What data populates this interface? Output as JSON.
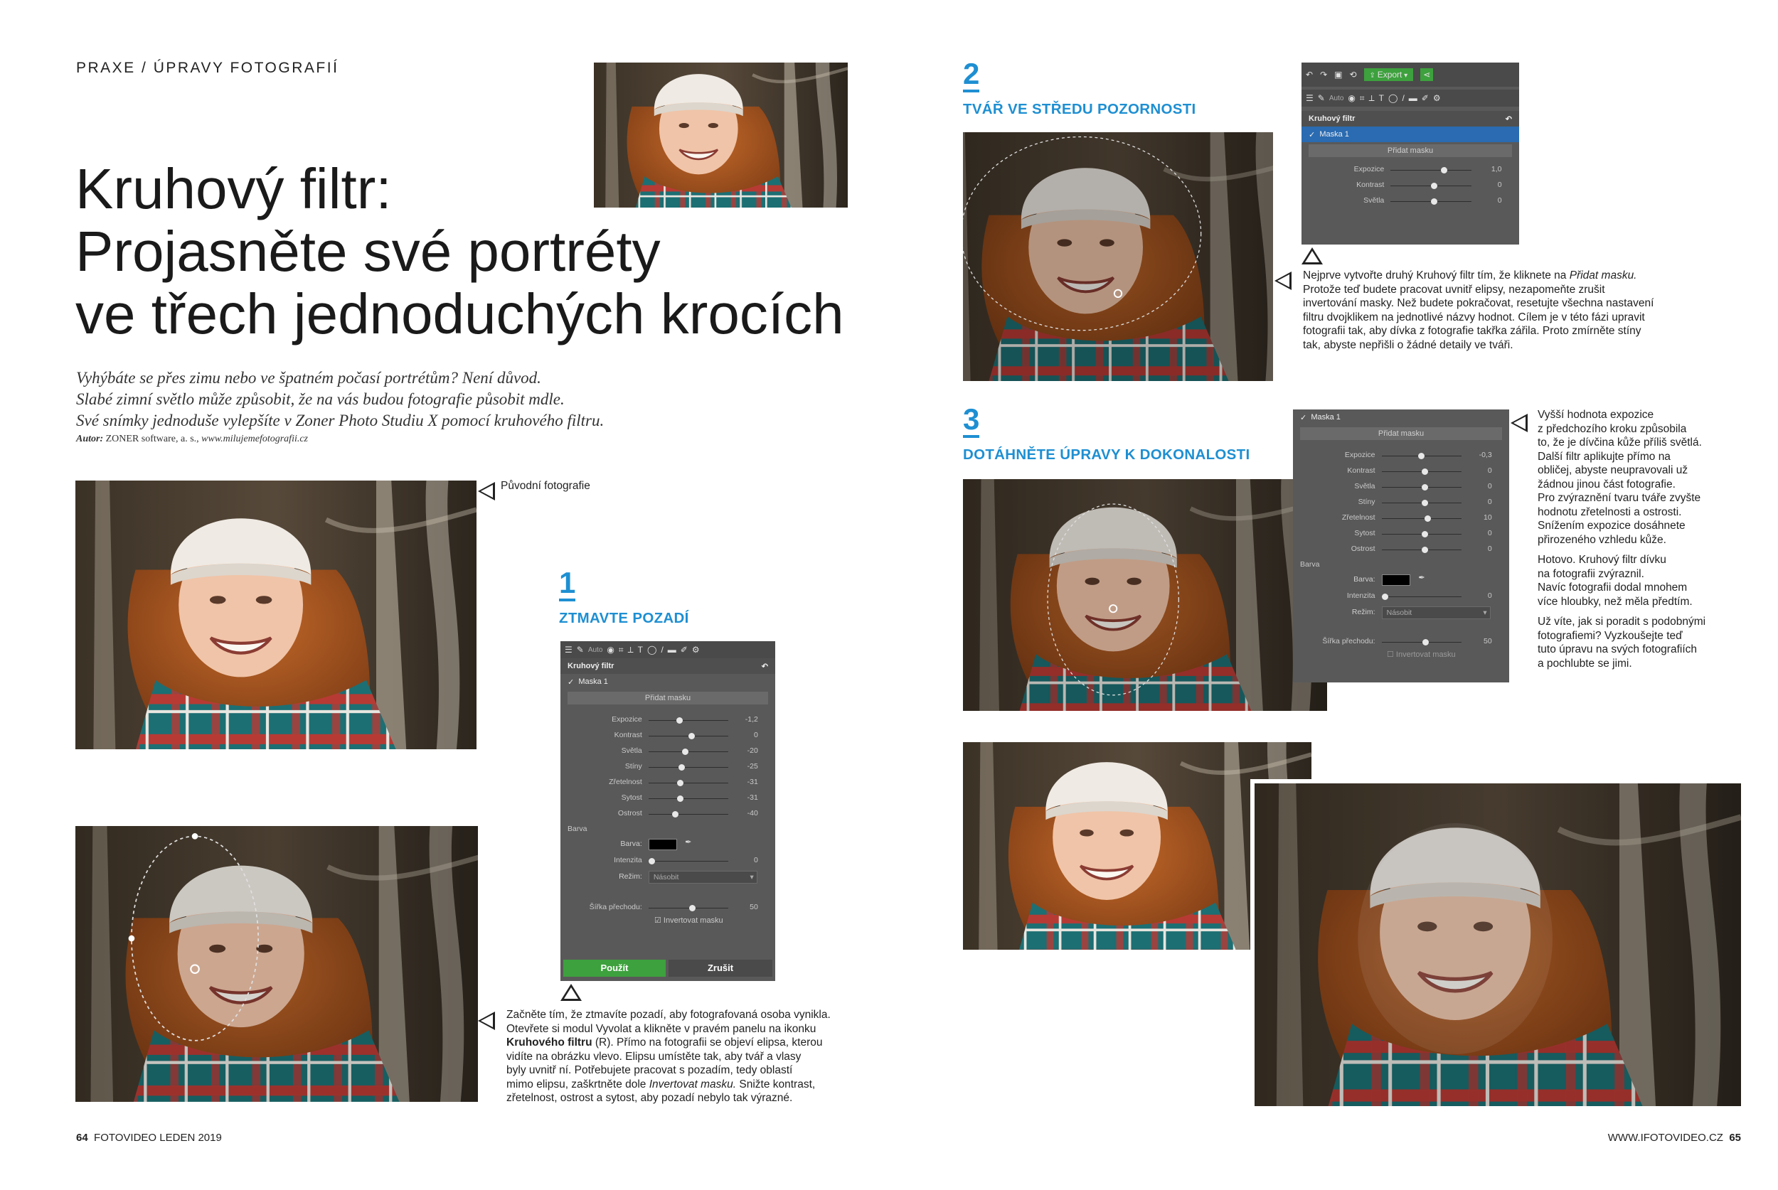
{
  "header": {
    "section": "PRAXE / ÚPRAVY FOTOGRAFIÍ"
  },
  "title": {
    "line1": "Kruhový filtr:",
    "line2": "Projasněte své portréty",
    "line3": "ve třech jednoduchých krocích"
  },
  "intro": {
    "line1": "Vyhýbáte se přes zimu nebo ve špatném počasí portrétům? Není důvod.",
    "line2": "Slabé zimní světlo může způsobit, že na vás budou fotografie působit mdle.",
    "line3": "Své snímky jednoduše vylepšíte v Zoner Photo Studiu X pomocí kruhového filtru.",
    "author_label": "Autor:",
    "author_name": "ZONER software, a. s.,",
    "author_url": "www.milujemefotografii.cz"
  },
  "captions": {
    "original": "Původní fotografie",
    "step1": {
      "l1": "Začněte tím, že ztmavíte pozadí, aby fotografovaná osoba vynikla.",
      "l2": "Otevřete si modul Vyvolat a klikněte v pravém panelu na ikonku",
      "l3b": "Kruhového filtru",
      "l3": " (R). Přímo na fotografii se objeví elipsa, kterou",
      "l4": "vidíte na obrázku vlevo. Elipsu umístěte tak, aby tvář a vlasy",
      "l5": "byly uvnitř ní. Potřebujete pracovat s pozadím, tedy oblastí",
      "l6a": "mimo elipsu, zaškrtněte dole ",
      "l6i": "Invertovat masku.",
      "l6b": " Snižte kontrast,",
      "l7": "zřetelnost, ostrost a sytost, aby pozadí nebylo tak výrazné."
    },
    "step2": {
      "l1a": "Nejprve vytvořte druhý Kruhový filtr tím, že kliknete na ",
      "l1i": "Přidat masku.",
      "l2": "Protože teď budete pracovat uvnitř elipsy, nezapomeňte zrušit",
      "l3": "invertování masky. Než budete pokračovat, resetujte všechna nastavení",
      "l4": "filtru dvojklikem na jednotlivé názvy hodnot. Cílem je v této fázi upravit",
      "l5": "fotografii tak, aby dívka z fotografie takřka zářila. Proto zmírněte stíny",
      "l6": "tak, abyste nepřišli o žádné detaily ve tváři."
    },
    "step3": {
      "p1": [
        "Vyšší hodnota expozice",
        "z předchozího kroku způsobila",
        "to, že je dívčina kůže příliš světlá.",
        "Další filtr aplikujte přímo na",
        "obličej, abyste neupravovali už",
        "žádnou jinou část fotografie.",
        "Pro zvýraznění tvaru tváře zvyšte",
        "hodnotu zřetelnosti a ostrosti.",
        "Snížením expozice dosáhnete",
        "přirozeného vzhledu kůže."
      ],
      "p2": [
        "Hotovo. Kruhový filtr dívku",
        "na fotografii zvýraznil.",
        "Navíc fotografii dodal mnohem",
        "více hloubky, než měla předtím."
      ],
      "p3": [
        "Už víte, jak si poradit s podobnými",
        "fotografiemi? Vyzkoušejte teď",
        "tuto úpravu na svých fotografiích",
        "a pochlubte se jimi."
      ]
    }
  },
  "steps": {
    "s1": {
      "num": "1",
      "title": "ZTMAVTE POZADÍ"
    },
    "s2": {
      "num": "2",
      "title": "TVÁŘ VE STŘEDU POZORNOSTI"
    },
    "s3": {
      "num": "3",
      "title": "DOTÁHNĚTE ÚPRAVY K DOKONALOSTI"
    }
  },
  "panel1": {
    "auto": "Auto",
    "filter_title": "Kruhový filtr",
    "mask": "Maska 1",
    "add_mask": "Přidat masku",
    "sliders": [
      {
        "label": "Expozice",
        "value": "-1,2",
        "pos": 0.35
      },
      {
        "label": "Kontrast",
        "value": "0",
        "pos": 0.5
      },
      {
        "label": "Světla",
        "value": "-20",
        "pos": 0.42
      },
      {
        "label": "Stíny",
        "value": "-25",
        "pos": 0.38
      },
      {
        "label": "Zřetelnost",
        "value": "-31",
        "pos": 0.36
      },
      {
        "label": "Sytost",
        "value": "-31",
        "pos": 0.36
      },
      {
        "label": "Ostrost",
        "value": "-40",
        "pos": 0.3
      }
    ],
    "color_section": "Barva",
    "color_label": "Barva:",
    "intensity_label": "Intenzita",
    "intensity_value": "0",
    "mode_label": "Režim:",
    "mode_value": "Násobit",
    "feather_label": "Šířka přechodu:",
    "feather_value": "50",
    "invert_label": "Invertovat masku",
    "apply": "Použít",
    "cancel": "Zrušit"
  },
  "panel2": {
    "auto": "Auto",
    "export": "Export",
    "filter_title": "Kruhový filtr",
    "mask": "Maska 1",
    "add_mask": "Přidat masku",
    "sliders": [
      {
        "label": "Expozice",
        "value": "1,0",
        "pos": 0.62
      },
      {
        "label": "Kontrast",
        "value": "0",
        "pos": 0.5
      },
      {
        "label": "Světla",
        "value": "0",
        "pos": 0.5
      }
    ]
  },
  "panel3": {
    "mask": "Maska 1",
    "add_mask": "Přidat masku",
    "sliders": [
      {
        "label": "Expozice",
        "value": "-0,3",
        "pos": 0.46
      },
      {
        "label": "Kontrast",
        "value": "0",
        "pos": 0.5
      },
      {
        "label": "Světla",
        "value": "0",
        "pos": 0.5
      },
      {
        "label": "Stíny",
        "value": "0",
        "pos": 0.5
      },
      {
        "label": "Zřetelnost",
        "value": "10",
        "pos": 0.54
      },
      {
        "label": "Sytost",
        "value": "0",
        "pos": 0.5
      },
      {
        "label": "Ostrost",
        "value": "0",
        "pos": 0.5
      }
    ],
    "color_section": "Barva",
    "color_label": "Barva:",
    "intensity_label": "Intenzita",
    "intensity_value": "0",
    "mode_label": "Režim:",
    "mode_value": "Násobit",
    "feather_label": "Šířka přechodu:",
    "feather_value": "50",
    "invert_label": "Invertovat masku"
  },
  "footer": {
    "left_page": "64",
    "left_text": "FOTOVIDEO LEDEN 2019",
    "right_text": "WWW.IFOTOVIDEO.CZ",
    "right_page": "65"
  }
}
